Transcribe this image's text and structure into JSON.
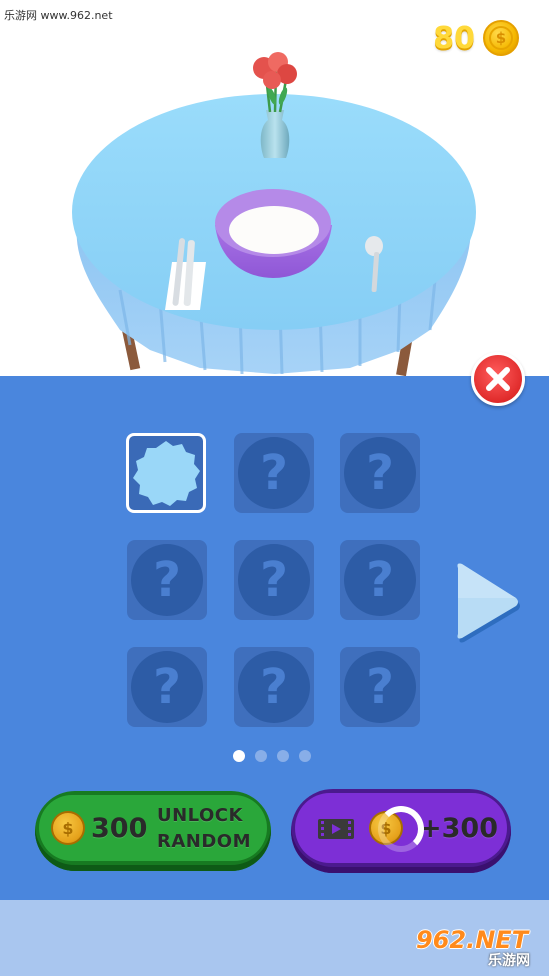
{
  "watermark_top": "乐游网 www.962.net",
  "coins": {
    "count": "80",
    "icon": "coin-icon",
    "symbol": "$"
  },
  "grid": {
    "slots": [
      {
        "state": "selected",
        "label": ""
      },
      {
        "state": "locked",
        "label": "?"
      },
      {
        "state": "locked",
        "label": "?"
      },
      {
        "state": "locked",
        "label": "?"
      },
      {
        "state": "locked",
        "label": "?"
      },
      {
        "state": "locked",
        "label": "?"
      },
      {
        "state": "locked",
        "label": "?"
      },
      {
        "state": "locked",
        "label": "?"
      },
      {
        "state": "locked",
        "label": "?"
      }
    ],
    "page_count": 4,
    "current_page": 1
  },
  "unlock_button": {
    "price": "300",
    "line1": "UNLOCK",
    "line2": "RANDOM",
    "coin_symbol": "$"
  },
  "ad_button": {
    "reward": "+300",
    "icon": "video-icon"
  },
  "watermark_bottom": {
    "brand": "962.NET",
    "sub": "乐游网"
  },
  "colors": {
    "panel": "#4a86dd",
    "tablecloth": "#8fd3f7",
    "unlock_green": "#2aa73a",
    "ad_purple": "#7d2fd6",
    "close_red": "#e02b2b"
  }
}
